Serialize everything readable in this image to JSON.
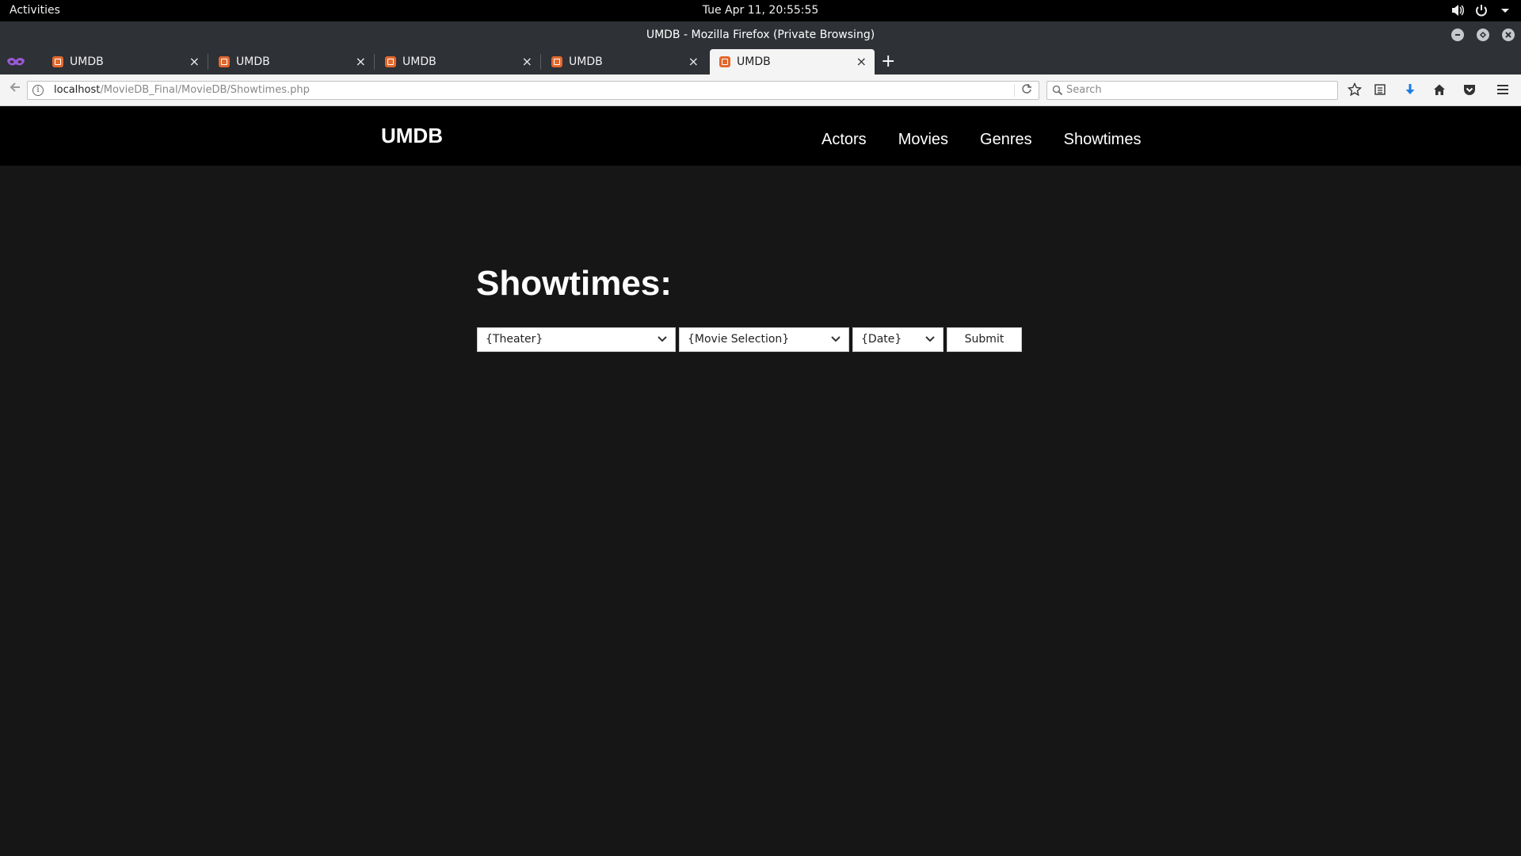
{
  "system": {
    "activities": "Activities",
    "clock": "Tue Apr 11, 20:55:55"
  },
  "window": {
    "title": "UMDB - Mozilla Firefox (Private Browsing)"
  },
  "tabs": [
    {
      "label": "UMDB",
      "active": false
    },
    {
      "label": "UMDB",
      "active": false
    },
    {
      "label": "UMDB",
      "active": false
    },
    {
      "label": "UMDB",
      "active": false
    },
    {
      "label": "UMDB",
      "active": true
    }
  ],
  "toolbar": {
    "url_host": "localhost",
    "url_path": "/MovieDB_Final/MovieDB/Showtimes.php",
    "search_placeholder": "Search"
  },
  "site": {
    "brand": "UMDB",
    "nav": [
      "Actors",
      "Movies",
      "Genres",
      "Showtimes"
    ]
  },
  "main": {
    "title": "Showtimes:",
    "theater_select": "{Theater}",
    "movie_select": "{Movie Selection}",
    "date_select": "{Date}",
    "submit_label": "Submit"
  }
}
